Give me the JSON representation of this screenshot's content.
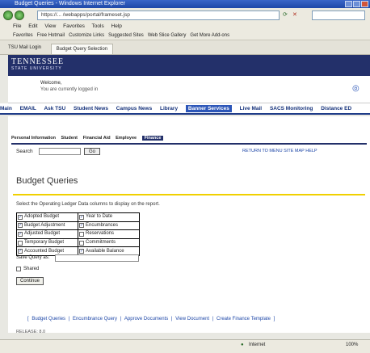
{
  "browser": {
    "title": "Budget Queries - Windows Internet Explorer",
    "address": "https://... /webapps/portal/frameset.jsp",
    "menu": [
      "File",
      "Edit",
      "View",
      "Favorites",
      "Tools",
      "Help"
    ],
    "favorites": [
      "Favorites",
      "Free Hotmail",
      "Customize Links",
      "Suggested Sites",
      "Web Slice Gallery",
      "Get More Add-ons"
    ],
    "tabs": [
      "TSU Mail Login",
      "Budget Query Selection"
    ],
    "status": "Internet",
    "zoom": "100%"
  },
  "banner": {
    "title": "TENNESSEE",
    "subtitle": "STATE UNIVERSITY"
  },
  "user": {
    "welcome": "Welcome, ",
    "note": "You are currently logged in"
  },
  "mainmenu": [
    "Main",
    "EMAIL",
    "Ask TSU",
    "Student News",
    "Campus News",
    "Library",
    "Banner Services",
    "Live Mail",
    "SACS Monitoring",
    "Distance ED"
  ],
  "subtabs": [
    "Personal Information",
    "Student",
    "Financial Aid",
    "Employee",
    "Finance"
  ],
  "search": {
    "label": "Search",
    "go": "Go",
    "links": "RETURN TO MENU   SITE MAP   HELP"
  },
  "page": {
    "title": "Budget Queries",
    "instructions": "Select the Operating Ledger Data columns to display on the report."
  },
  "columns": [
    [
      {
        "label": "Adopted Budget",
        "checked": true
      },
      {
        "label": "Year to Date",
        "checked": true
      }
    ],
    [
      {
        "label": "Budget Adjustment",
        "checked": true
      },
      {
        "label": "Encumbrances",
        "checked": true
      }
    ],
    [
      {
        "label": "Adjusted Budget",
        "checked": true
      },
      {
        "label": "Reservations",
        "checked": false
      }
    ],
    [
      {
        "label": "Temporary Budget",
        "checked": false
      },
      {
        "label": "Commitments",
        "checked": false
      }
    ],
    [
      {
        "label": "Accounted Budget",
        "checked": true
      },
      {
        "label": "Available Balance",
        "checked": true
      }
    ]
  ],
  "save": {
    "label": "Save Query as:",
    "shared_label": "Shared",
    "continue": "Continue"
  },
  "footer_links": [
    "Budget Queries",
    "Encumbrance Query",
    "Approve Documents",
    "View Document",
    "Create Finance Template"
  ],
  "release": "RELEASE: 8.0"
}
